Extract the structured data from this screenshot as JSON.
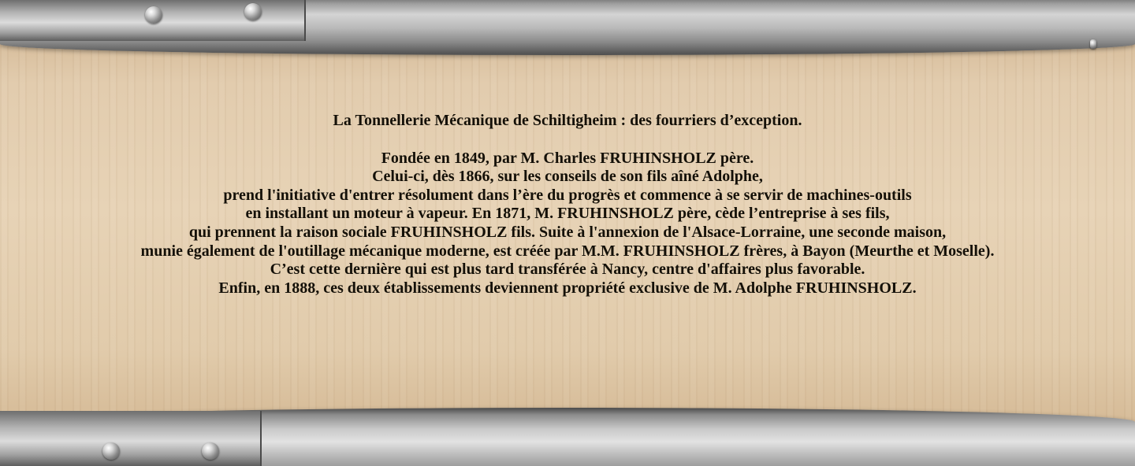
{
  "inscription": {
    "title": "La Tonnellerie Mécanique de Schiltigheim : des fourriers d’exception.",
    "lines": [
      "Fondée en 1849, par M. Charles FRUHINSHOLZ père.",
      "Celui-ci, dès 1866, sur les conseils de son fils aîné Adolphe,",
      "prend l'initiative d'entrer résolument dans l’ère du progrès et commence à se servir de machines-outils",
      "en installant un moteur à vapeur. En 1871, M. FRUHINSHOLZ père, cède l’entreprise à ses fils,",
      "qui prennent la raison sociale FRUHINSHOLZ fils. Suite à l'annexion de l'Alsace-Lorraine, une seconde maison,",
      "munie également de l'outillage mécanique moderne, est créée par M.M. FRUHINSHOLZ frères, à Bayon (Meurthe et Moselle).",
      "C’est cette dernière qui est plus tard transférée à Nancy, centre d'affaires plus favorable.",
      "Enfin, en 1888, ces deux établissements deviennent propriété exclusive de M. Adolphe FRUHINSHOLZ."
    ]
  },
  "colors": {
    "wood": "#e2ccae",
    "steel": "#b9b9b9",
    "text": "#141008"
  }
}
